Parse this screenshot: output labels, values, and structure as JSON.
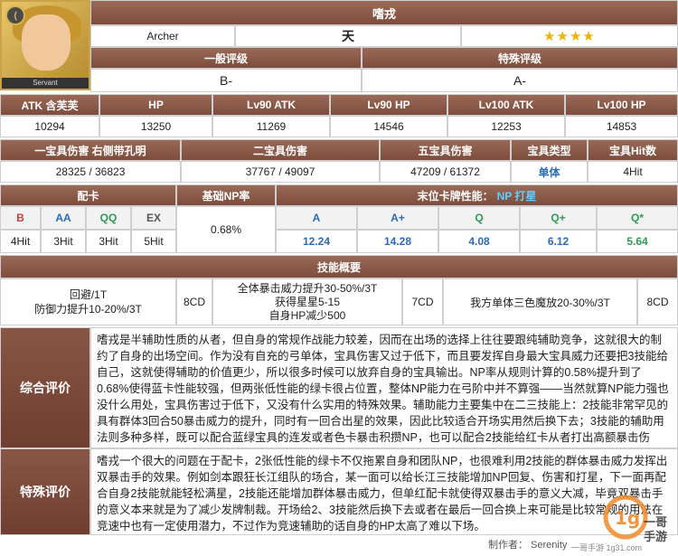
{
  "servant": {
    "name": "嗜戎",
    "class": "Archer",
    "attribute": "天",
    "rarity_stars": "★★★★",
    "portrait_label": "Servant",
    "portrait_stars": "★★★★"
  },
  "ratings": {
    "general_label": "一般评级",
    "special_label": "特殊评级",
    "general": "B-",
    "special": "A-"
  },
  "stats": {
    "headers": [
      "ATK 含芙芙",
      "HP",
      "Lv90 ATK",
      "Lv90 HP",
      "Lv100 ATK",
      "Lv100 HP"
    ],
    "values": [
      "10294",
      "13250",
      "11269",
      "14546",
      "12253",
      "14853"
    ]
  },
  "np": {
    "headers": [
      "一宝具伤害 右侧带孔明",
      "二宝具伤害",
      "五宝具伤害",
      "宝具类型",
      "宝具Hit数"
    ],
    "values": [
      "28325 / 36823",
      "37767 / 49097",
      "47209 / 61372",
      "单体",
      "4Hit"
    ]
  },
  "cards": {
    "deck_label": "配卡",
    "np_rate_label": "基础NP率",
    "np_rate": "0.68%",
    "last_card_label": "末位卡牌性能：",
    "last_card_np": "NP 打星",
    "deck": [
      {
        "letter": "B",
        "hits": "4Hit"
      },
      {
        "letter": "AA",
        "hits": "3Hit"
      },
      {
        "letter": "QQ",
        "hits": "3Hit"
      },
      {
        "letter": "EX",
        "hits": "5Hit"
      }
    ],
    "last": [
      {
        "letter": "A",
        "value": "12.24"
      },
      {
        "letter": "A+",
        "value": "14.28"
      },
      {
        "letter": "Q",
        "value": "4.08"
      },
      {
        "letter": "Q+",
        "value": "6.12"
      },
      {
        "letter": "Q*",
        "value": "5.64"
      }
    ]
  },
  "skills": {
    "label": "技能概要",
    "items": [
      {
        "desc_line1": "回避/1T",
        "desc_line2": "防御力提升10-20%/3T",
        "desc_line3": "",
        "cd": "8CD"
      },
      {
        "desc_line1": "全体暴击威力提升30-50%/3T",
        "desc_line2": "获得星星5-15",
        "desc_line3": "自身HP减少500",
        "cd": "7CD"
      },
      {
        "desc_line1": "我方单体三色魔放20-30%/3T",
        "desc_line2": "",
        "desc_line3": "",
        "cd": "8CD"
      }
    ]
  },
  "overall": {
    "label": "综合评价",
    "text": "嗜戎是半辅助性质的从者，但自身的常规作战能力较差，因而在出场的选择上往往要跟纯辅助竞争，这就很大的制约了自身的出场空间。作为没有自充的弓单体，宝具伤害又过于低下，而且要发挥自身最大宝具威力还要把3技能给自己，这就使得辅助的价值更少，所以很多时候可以放弃自身的宝具输出。NP率从规则计算的0.58%提升到了0.68%使得蓝卡性能较强，但两张低性能的绿卡很占位置，整体NP能力在弓阶中并不算强——当然就算NP能力强也没什么用处，宝具伤害过于低下，又没有什么实用的特殊效果。辅助能力主要集中在二三技能上：2技能非常罕见的具有群体3回合50暴击威力的提升，同时有一回合出星的效果，因此比较适合开场实用然后换下去；3技能的辅助用法则多种多样，既可以配合蓝绿宝具的连发或者色卡暴击积攒NP，也可以配合2技能给红卡从者打出高额暴击伤害。"
  },
  "special_eval": {
    "label": "特殊评价",
    "text": "嗜戎一个很大的问题在于配卡，2张低性能的绿卡不仅拖累自身和团队NP，也很难利用2技能的群体暴击威力发挥出双暴击手的效果。例如剑本跟狂长江组队的场合，某一面可以给长江三技能增加NP回复、伤害和打星，下一面再配合自身2技能就能轻松满星，2技能还能增加群体暴击威力，但单红配卡就使得双暴击手的意义大减，毕竟双暴击手的意义本来就是为了减少发牌制裁。开场给2、3技能然后换下去或者在最后一回合换上来可能是比较常规的用法在竞速中也有一定使用潜力，不过作为竞速辅助的话自身的HP太高了难以下场。"
  },
  "footer": {
    "maker": "制作者： Serenity",
    "site": "一哥手游 1g31.com"
  }
}
